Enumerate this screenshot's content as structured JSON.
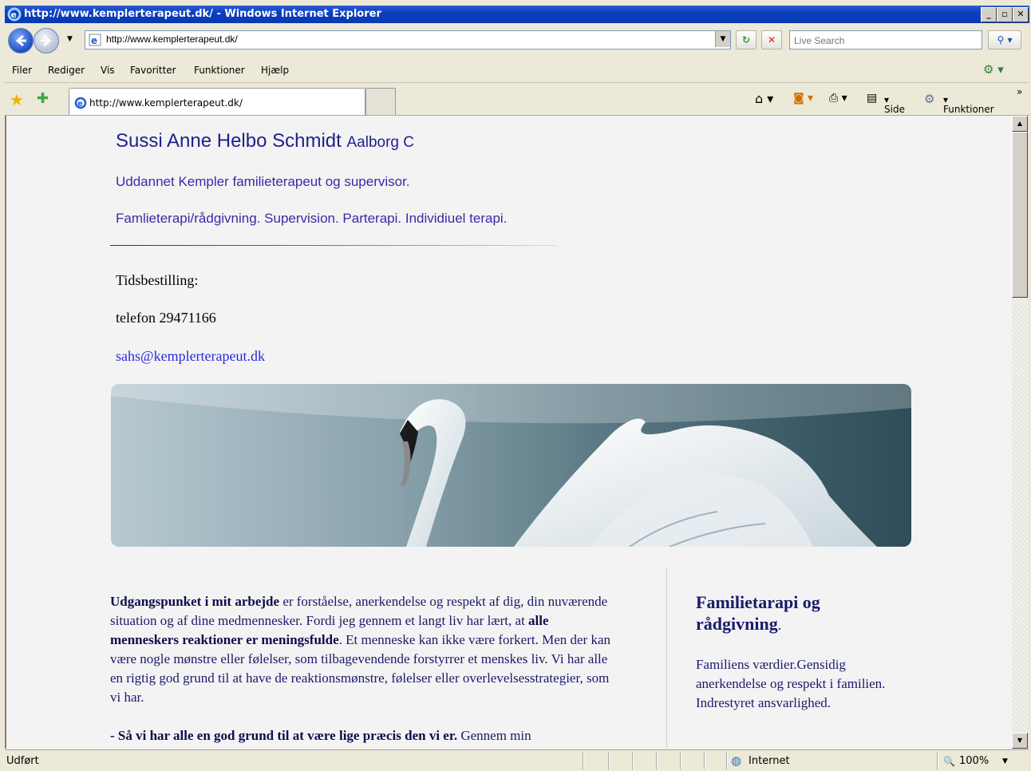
{
  "window": {
    "title": "http://www.kemplerterapeut.dk/ - Windows Internet Explorer",
    "min": "_",
    "max": "▫",
    "close": "✕"
  },
  "address": {
    "url": "http://www.kemplerterapeut.dk/",
    "search_placeholder": "Live Search"
  },
  "menu": {
    "items": [
      "Filer",
      "Rediger",
      "Vis",
      "Favoritter",
      "Funktioner",
      "Hjælp"
    ]
  },
  "tabs": {
    "active_title": "http://www.kemplerterapeut.dk/"
  },
  "command_bar": {
    "side_label": "Side",
    "funktioner_label": "Funktioner",
    "more": "»"
  },
  "page": {
    "name": "Sussi Anne Helbo Schmidt",
    "city": "Aalborg C",
    "subtitle": "Uddannet Kempler familieterapeut og supervisor.",
    "services": "Famlieterapi/rådgivning. Supervision. Parterapi. Individiuel terapi.",
    "booking_label": "Tidsbestilling:",
    "phone": "telefon 29471166",
    "email": "sahs@kemplerterapeut.dk",
    "body_bold_1": "Udgangspunket i mit arbejde",
    "body_text_1": " er forståelse, anerkendelse og respekt af dig, din nuværende situation og af dine medmennesker.  Fordi jeg gennem et langt liv har lært, at ",
    "body_bold_2": "alle menneskers reaktioner er meningsfulde",
    "body_text_2": ". Et menneske kan ikke være forkert. Men der kan være nogle mønstre eller følelser, som tilbagevendende forstyrrer et menskes liv. Vi har alle en rigtig god grund til at have de reaktionsmønstre, følelser eller overlevelsesstrategier, som vi har.",
    "body_bold_3": "- Så vi har alle en god grund til at være lige præcis den vi er.",
    "body_text_3": " Gennem min",
    "side_title": "Familietarapi og rådgivning",
    "side_title_dot": ".",
    "side_text": "Familiens værdier.Gensidig anerkendelse og respekt i familien. Indrestyret ansvarlighed."
  },
  "status": {
    "left": "Udført",
    "zone": "Internet",
    "zoom": "100%"
  },
  "colors": {
    "titlebar": "#0a3fbf",
    "link": "#3a2aa8",
    "heading": "#1f1f8f"
  }
}
